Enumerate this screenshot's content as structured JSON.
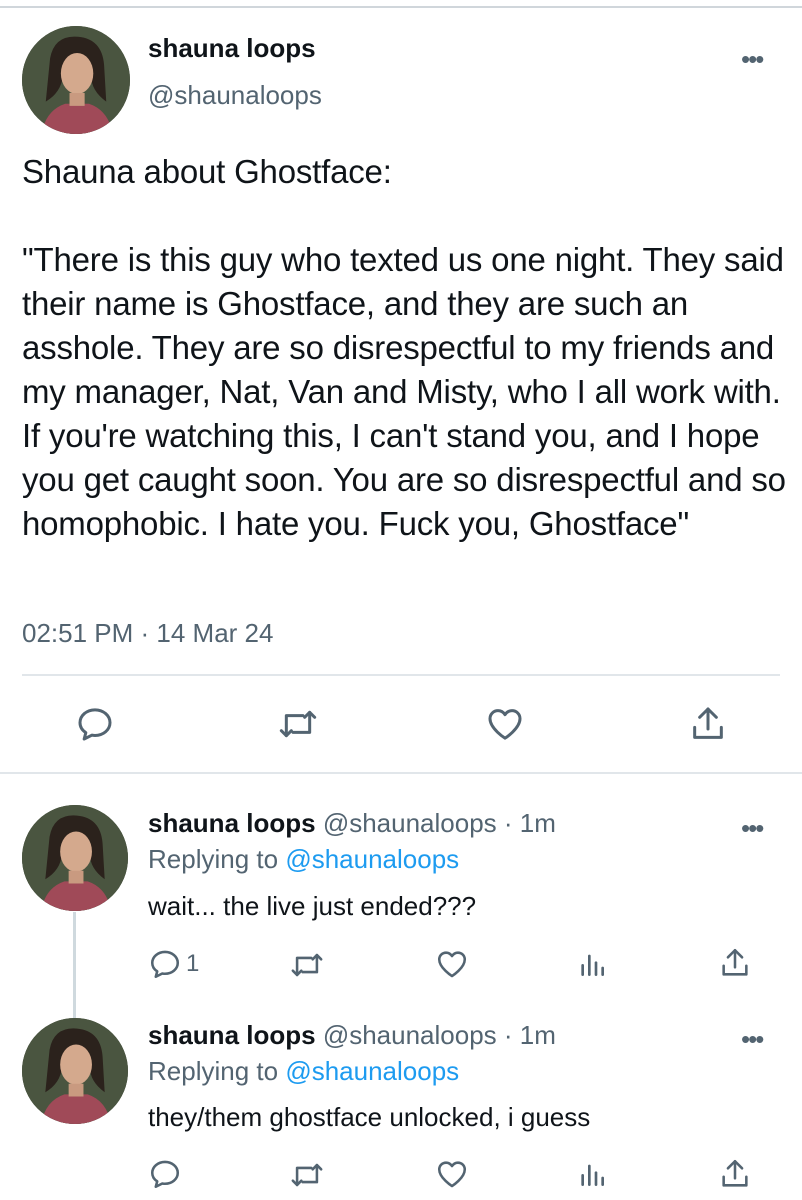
{
  "main_tweet": {
    "author_name": "shauna loops",
    "author_handle": "@shaunaloops",
    "more_label": "•••",
    "text": "Shauna about Ghostface:\n\n\"There is this guy who texted us one night. They said their name is Ghostface, and they are such an asshole. They are so disrespectful to my friends and my manager, Nat, Van and Misty, who I all work with. If you're watching this, I can't stand you, and I hope you get caught soon. You are so disrespectful and so homophobic. I hate you. Fuck you, Ghostface\"",
    "timestamp": "02:51 PM · 14 Mar 24",
    "actions": [
      "reply-icon",
      "retweet-icon",
      "like-icon",
      "share-icon"
    ]
  },
  "replies": [
    {
      "author_name": "shauna loops",
      "meta": "@shaunaloops · 1m",
      "replying_prefix": "Replying to ",
      "replying_to": "@shaunaloops",
      "text": "wait... the live just ended???",
      "reply_count": "1",
      "more_label": "•••"
    },
    {
      "author_name": "shauna loops",
      "meta": "@shaunaloops · 1m",
      "replying_prefix": "Replying to ",
      "replying_to": "@shaunaloops",
      "text": "they/them ghostface unlocked, i guess",
      "reply_count": "",
      "more_label": "•••"
    }
  ],
  "colors": {
    "text": "#0f1419",
    "secondary": "#536471",
    "link": "#1d9bf0",
    "divider": "#e1e6ea"
  }
}
